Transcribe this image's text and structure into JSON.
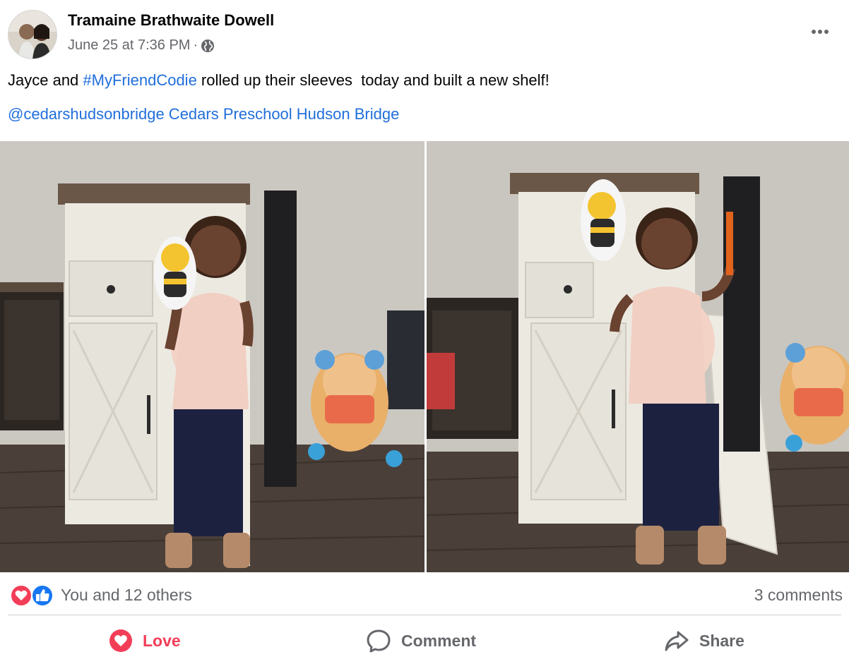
{
  "post": {
    "author": "Tramaine Brathwaite Dowell",
    "timestamp": "June 25 at 7:36 PM",
    "separator": "·",
    "audience_icon": "globe-icon",
    "more_icon": "more-options-icon",
    "text_line1": {
      "before": "Jayce and ",
      "hashtag": "#MyFriendCodie",
      "after": " rolled up their sleeves  today and built a new shelf!"
    },
    "text_line2": "@cedarshudsonbridge Cedars Preschool Hudson Bridge"
  },
  "reactions": {
    "summary": "You and 12 others",
    "comments": "3 comments",
    "icons": [
      "love-reaction-icon",
      "like-reaction-icon"
    ]
  },
  "actions": {
    "love_label": "Love",
    "comment_label": "Comment",
    "share_label": "Share"
  },
  "colors": {
    "link": "#216fdb",
    "love": "#f33e58",
    "like": "#1877f2",
    "muted": "#65676b"
  }
}
